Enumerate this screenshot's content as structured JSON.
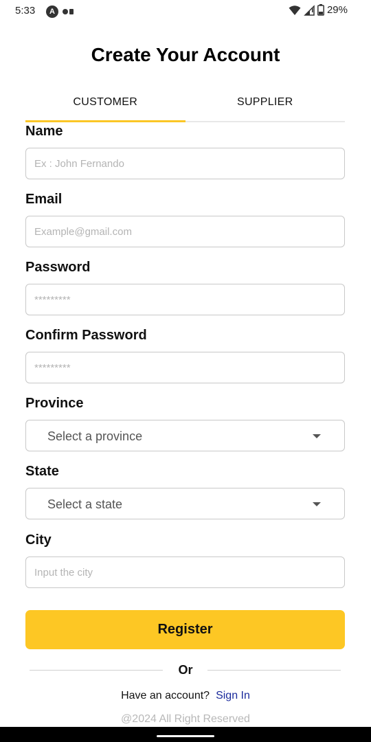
{
  "status": {
    "time": "5:33",
    "battery": "29%"
  },
  "title": "Create Your Account",
  "tabs": [
    {
      "label": "CUSTOMER",
      "active": true
    },
    {
      "label": "SUPPLIER",
      "active": false
    }
  ],
  "form": {
    "name": {
      "label": "Name",
      "placeholder": "Ex : John Fernando",
      "value": ""
    },
    "email": {
      "label": "Email",
      "placeholder": "Example@gmail.com",
      "value": ""
    },
    "password": {
      "label": "Password",
      "placeholder": "*********",
      "value": ""
    },
    "confirm_password": {
      "label": "Confirm Password",
      "placeholder": "*********",
      "value": ""
    },
    "province": {
      "label": "Province",
      "selected": "Select a province"
    },
    "state": {
      "label": "State",
      "selected": "Select a state"
    },
    "city": {
      "label": "City",
      "placeholder": "Input the city",
      "value": ""
    }
  },
  "register_label": "Register",
  "or_label": "Or",
  "signin": {
    "prompt": "Have an account?",
    "link": "Sign In"
  },
  "footer": "@2024 All Right Reserved",
  "colors": {
    "accent": "#fdc724",
    "link": "#1a2a9c"
  }
}
